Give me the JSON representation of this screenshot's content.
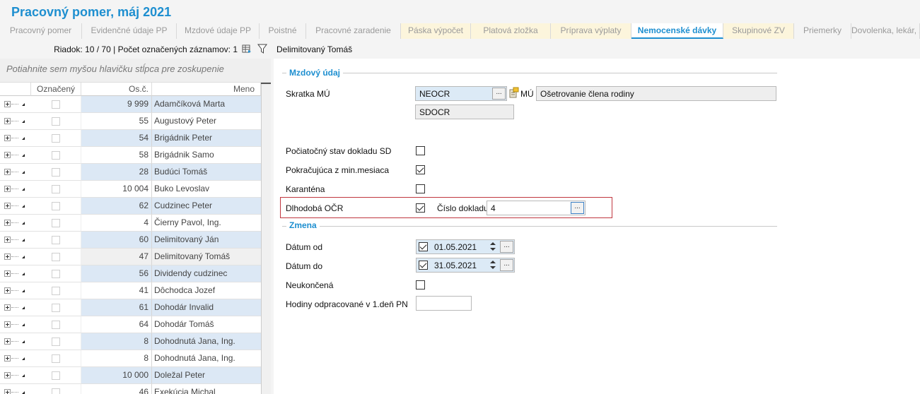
{
  "window": {
    "title": "Pracovný pomer, máj 2021"
  },
  "tabs": [
    {
      "label": "Pracovný pomer",
      "style": "plain"
    },
    {
      "label": "Evidenčné údaje PP",
      "style": "plain"
    },
    {
      "label": "Mzdové údaje PP",
      "style": "plain"
    },
    {
      "label": "Poistné",
      "style": "plain"
    },
    {
      "label": "Pracovné zaradenie",
      "style": "plain"
    },
    {
      "label": "Páska výpočet",
      "style": "yellow"
    },
    {
      "label": "Platová zložka",
      "style": "yellow"
    },
    {
      "label": "Príprava výplaty",
      "style": "yellow"
    },
    {
      "label": "Nemocenské dávky",
      "style": "active"
    },
    {
      "label": "Skupinové ZV",
      "style": "yellow"
    },
    {
      "label": "Priemerky",
      "style": "plain"
    },
    {
      "label": "Dovolenka, lekár, z",
      "style": "plain"
    }
  ],
  "left": {
    "row_info": "Riadok: 10 / 70 | Počet označených záznamov: 1",
    "group_hint": "Potiahnite sem myšou hlavičku stĺpca pre zoskupenie",
    "columns": {
      "checked": "Označený",
      "number": "Os.č.",
      "name": "Meno"
    },
    "rows": [
      {
        "number": "9 999",
        "name": "Adamčíková Marta",
        "shade": "blue"
      },
      {
        "number": "55",
        "name": "Augustový Peter",
        "shade": "white"
      },
      {
        "number": "54",
        "name": "Brigádnik Peter",
        "shade": "blue"
      },
      {
        "number": "58",
        "name": "Brigádnik Samo",
        "shade": "white"
      },
      {
        "number": "28",
        "name": "Budúci Tomáš",
        "shade": "blue"
      },
      {
        "number": "10 004",
        "name": "Buko Levoslav",
        "shade": "white"
      },
      {
        "number": "62",
        "name": "Cudzinec Peter",
        "shade": "blue"
      },
      {
        "number": "4",
        "name": "Čierny Pavol, Ing.",
        "shade": "white"
      },
      {
        "number": "60",
        "name": "Delimitovaný Ján",
        "shade": "blue"
      },
      {
        "number": "47",
        "name": "Delimitovaný Tomáš",
        "shade": "sel"
      },
      {
        "number": "56",
        "name": "Dividendy cudzinec",
        "shade": "blue"
      },
      {
        "number": "41",
        "name": "Dôchodca Jozef",
        "shade": "white"
      },
      {
        "number": "61",
        "name": "Dohodár Invalid",
        "shade": "blue"
      },
      {
        "number": "64",
        "name": "Dohodár Tomáš",
        "shade": "white"
      },
      {
        "number": "8",
        "name": "Dohodnutá Jana, Ing.",
        "shade": "blue"
      },
      {
        "number": "8",
        "name": "Dohodnutá Jana, Ing.",
        "shade": "white"
      },
      {
        "number": "10 000",
        "name": "Doležal Peter",
        "shade": "blue"
      },
      {
        "number": "46",
        "name": "Exekúcia Michal",
        "shade": "white"
      }
    ]
  },
  "right": {
    "header": "Delimitovaný Tomáš",
    "section_mzdovy": "Mzdový údaj",
    "skratka_label": "Skratka MÚ",
    "skratka_value": "NEOCR",
    "mu_label": "MÚ",
    "mu_value": "Ošetrovanie člena rodiny",
    "sdocr_value": "SDOCR",
    "pociatocny_label": "Počiatočný stav dokladu SD",
    "pokracujuca_label": "Pokračujúca z min.mesiaca",
    "karantena_label": "Karanténa",
    "dlhodoba_label": "Dlhodobá OČR",
    "cislo_label": "Číslo dokladu",
    "cislo_value": "4",
    "section_zmena": "Zmena",
    "datum_od_label": "Dátum od",
    "datum_od_value": "01.05.2021",
    "datum_do_label": "Dátum do",
    "datum_do_value": "31.05.2021",
    "neukoncena_label": "Neukončená",
    "hodiny_label": "Hodiny odpracované v 1.deň PN",
    "hodiny_value": "",
    "ellipsis": "..."
  },
  "colors": {
    "accent": "#1e8fd0",
    "row_blue": "#dce8f5",
    "highlight_border": "#c0373f",
    "tab_yellow": "#fcf5dc"
  }
}
